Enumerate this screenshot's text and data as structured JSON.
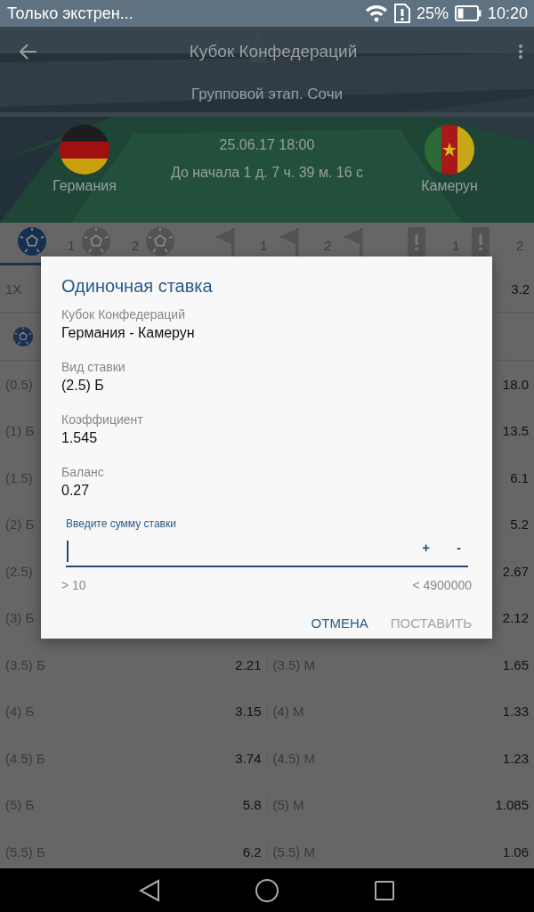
{
  "status_bar": {
    "notification": "Только экстрен...",
    "battery_percent": "25%",
    "time": "10:20"
  },
  "header": {
    "title": "Кубок Конфедераций",
    "stage": "Групповой этап. Сочи",
    "datetime": "25.06.17 18:00",
    "countdown": "До начала 1 д. 7 ч. 39 м. 16 с",
    "home_team": "Германия",
    "away_team": "Камерун"
  },
  "tabs": [
    {
      "kind": "ball",
      "selected": true
    },
    {
      "kind": "ball",
      "number": "1",
      "selected": false
    },
    {
      "kind": "ball",
      "number": "2",
      "selected": false
    },
    {
      "kind": "flag",
      "selected": false
    },
    {
      "kind": "flag",
      "number": "1",
      "selected": false
    },
    {
      "kind": "flag",
      "number": "2",
      "selected": false
    },
    {
      "kind": "alert",
      "selected": false
    },
    {
      "kind": "alert",
      "number": "1",
      "selected": false
    },
    {
      "number": "2",
      "selected": false
    }
  ],
  "top_row": {
    "label": "1X",
    "value": "3.2"
  },
  "bets": [
    {
      "left_label": "(0.5)",
      "right_value": "18.0"
    },
    {
      "left_label": "(1) Б",
      "right_value": "13.5"
    },
    {
      "left_label": "(1.5)",
      "right_value": "6.1"
    },
    {
      "left_label": "(2) Б",
      "right_value": "5.2"
    },
    {
      "left_label": "(2.5)",
      "right_value": "2.67"
    },
    {
      "left_label": "(3) Б",
      "right_value": "2.12"
    },
    {
      "left_label": "(3.5) Б",
      "left_value": "2.21",
      "right_label": "(3.5) М",
      "right_value": "1.65"
    },
    {
      "left_label": "(4) Б",
      "left_value": "3.15",
      "right_label": "(4) М",
      "right_value": "1.33"
    },
    {
      "left_label": "(4.5) Б",
      "left_value": "3.74",
      "right_label": "(4.5) М",
      "right_value": "1.23"
    },
    {
      "left_label": "(5) Б",
      "left_value": "5.8",
      "right_label": "(5) М",
      "right_value": "1.085"
    },
    {
      "left_label": "(5.5) Б",
      "left_value": "6.2",
      "right_label": "(5.5) М",
      "right_value": "1.06"
    }
  ],
  "dialog": {
    "title": "Одиночная ставка",
    "fields": [
      {
        "label": "Кубок Конфедераций",
        "value": "Германия - Камерун"
      },
      {
        "label": "Вид ставки",
        "value": "(2.5) Б"
      },
      {
        "label": "Коэффициент",
        "value": "1.545"
      },
      {
        "label": "Баланс",
        "value": "0.27"
      }
    ],
    "amount": {
      "label": "Введите сумму ставки",
      "plus": "+",
      "minus": "-",
      "min": "> 10",
      "max": "< 4900000"
    },
    "buttons": [
      {
        "label": "ОТМЕНА",
        "disabled": false
      },
      {
        "label": "ПОСТАВИТЬ",
        "disabled": true
      }
    ]
  }
}
